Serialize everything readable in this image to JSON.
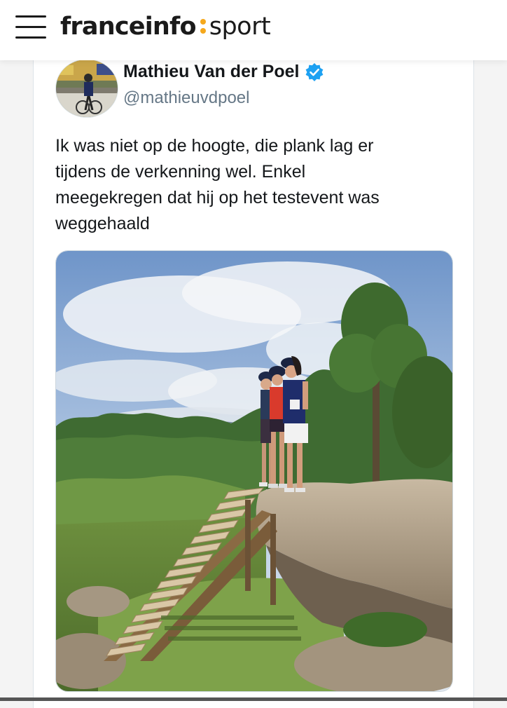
{
  "header": {
    "menu_icon": "hamburger-menu-icon",
    "brand": "franceinfo",
    "section": "sport",
    "brand_accent": "#f5a81c"
  },
  "tweet": {
    "author_name": "Mathieu Van der Poel",
    "handle": "@mathieuvdpoel",
    "verified_icon": "verified-badge-icon",
    "verified_color": "#1da1f2",
    "text_lines": [
      "Ik was niet op de hoogte, die plank lag er",
      "tijdens de verkenning wel. Enkel",
      "meegekregen dat hij op het testevent was",
      "weggehaald"
    ]
  }
}
